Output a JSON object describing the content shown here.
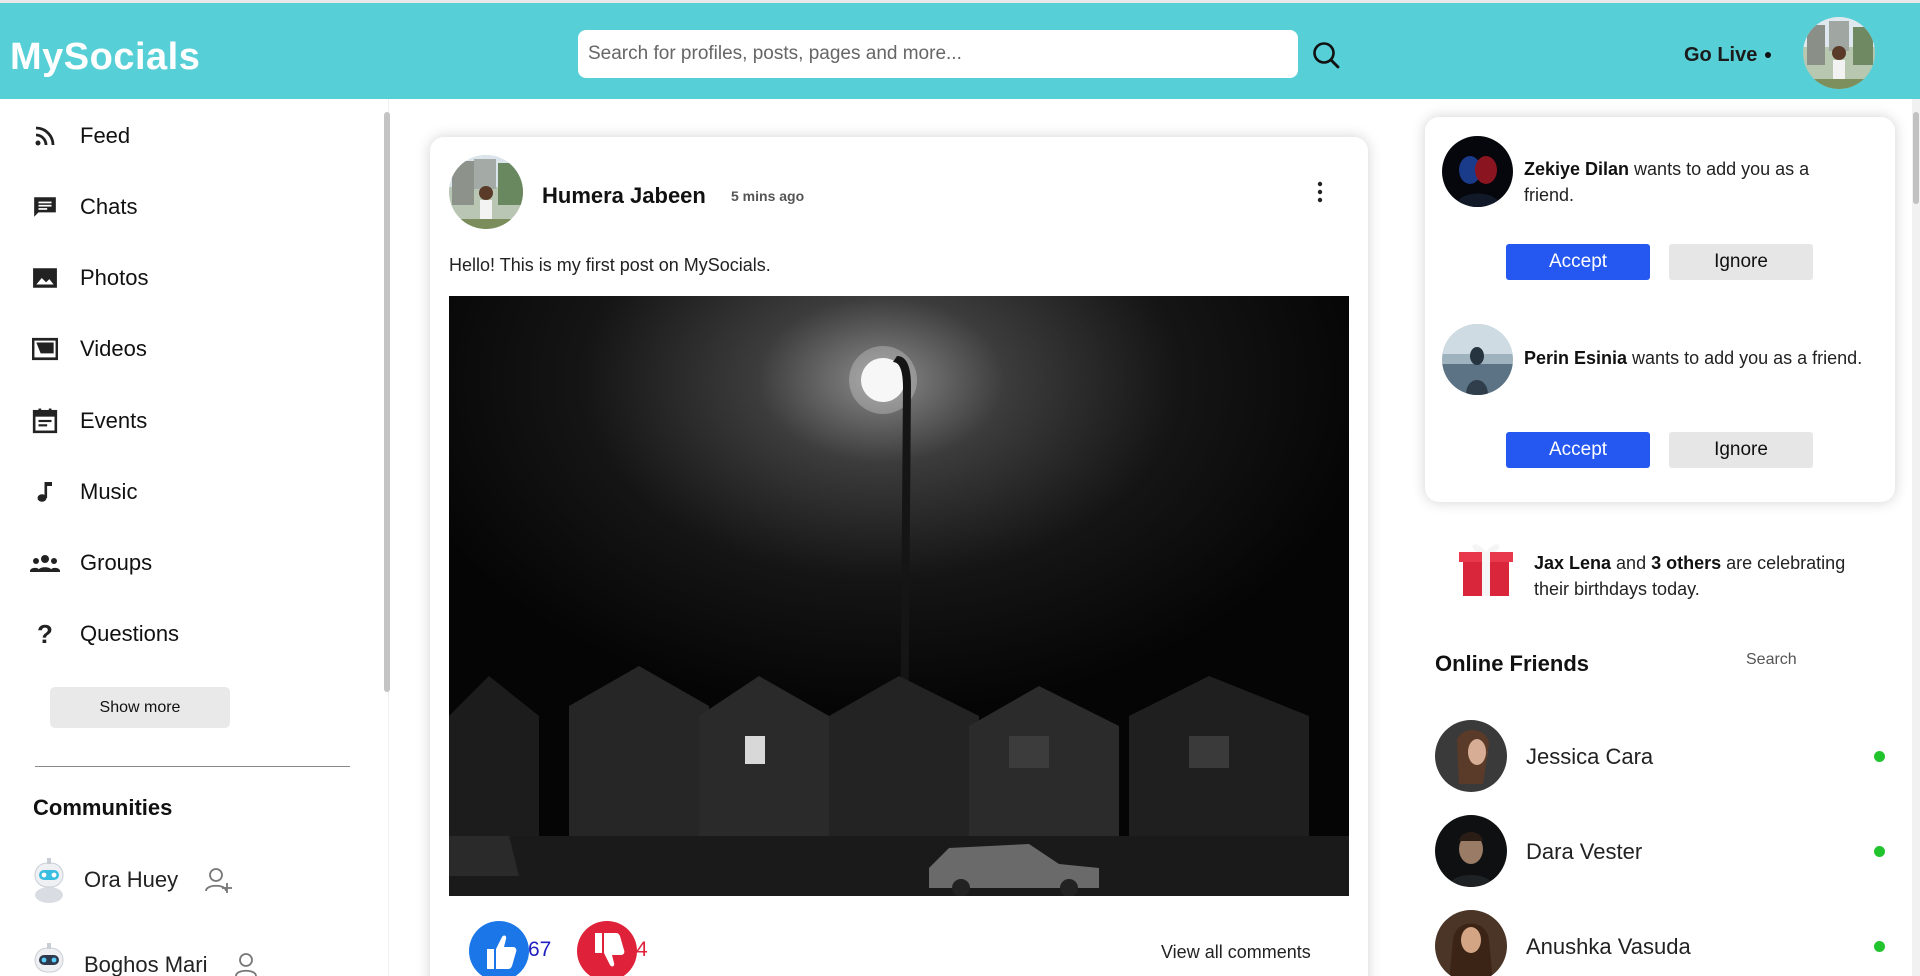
{
  "header": {
    "logo": "MySocials",
    "search_placeholder": "Search for profiles, posts, pages and more...",
    "go_live": "Go Live"
  },
  "sidebar": {
    "items": [
      {
        "label": "Feed",
        "icon": "rss-icon"
      },
      {
        "label": "Chats",
        "icon": "chat-icon"
      },
      {
        "label": "Photos",
        "icon": "photo-icon"
      },
      {
        "label": "Videos",
        "icon": "video-icon"
      },
      {
        "label": "Events",
        "icon": "calendar-icon"
      },
      {
        "label": "Music",
        "icon": "music-note-icon"
      },
      {
        "label": "Groups",
        "icon": "groups-icon"
      },
      {
        "label": "Questions",
        "icon": "question-icon"
      }
    ],
    "show_more": "Show more",
    "communities_title": "Communities",
    "communities": [
      {
        "name": "Ora Huey"
      },
      {
        "name": "Boghos Mari"
      }
    ]
  },
  "post": {
    "author": "Humera Jabeen",
    "time": "5 mins ago",
    "text": "Hello! This is my first post on MySocials.",
    "likes": "67",
    "dislikes": "4",
    "view_comments": "View all comments"
  },
  "friend_requests": [
    {
      "name": "Zekiye Dilan",
      "message": " wants to add you as a friend.",
      "accept": "Accept",
      "ignore": "Ignore"
    },
    {
      "name": "Perin Esinia",
      "message": " wants to add you as a friend.",
      "accept": "Accept",
      "ignore": "Ignore"
    }
  ],
  "birthday": {
    "name": "Jax Lena",
    "and": " and ",
    "others": "3 others",
    "rest": " are celebrating their birthdays today."
  },
  "online_friends": {
    "title": "Online Friends",
    "search_label": "Search",
    "friends": [
      {
        "name": "Jessica Cara",
        "status": "online"
      },
      {
        "name": "Dara Vester",
        "status": "online"
      },
      {
        "name": "Anushka Vasuda",
        "status": "online"
      }
    ]
  },
  "colors": {
    "topbar": "#56cfd6",
    "accept": "#2458f0",
    "like": "#1b77e8",
    "dislike": "#e0213a",
    "online": "#22c42e"
  }
}
